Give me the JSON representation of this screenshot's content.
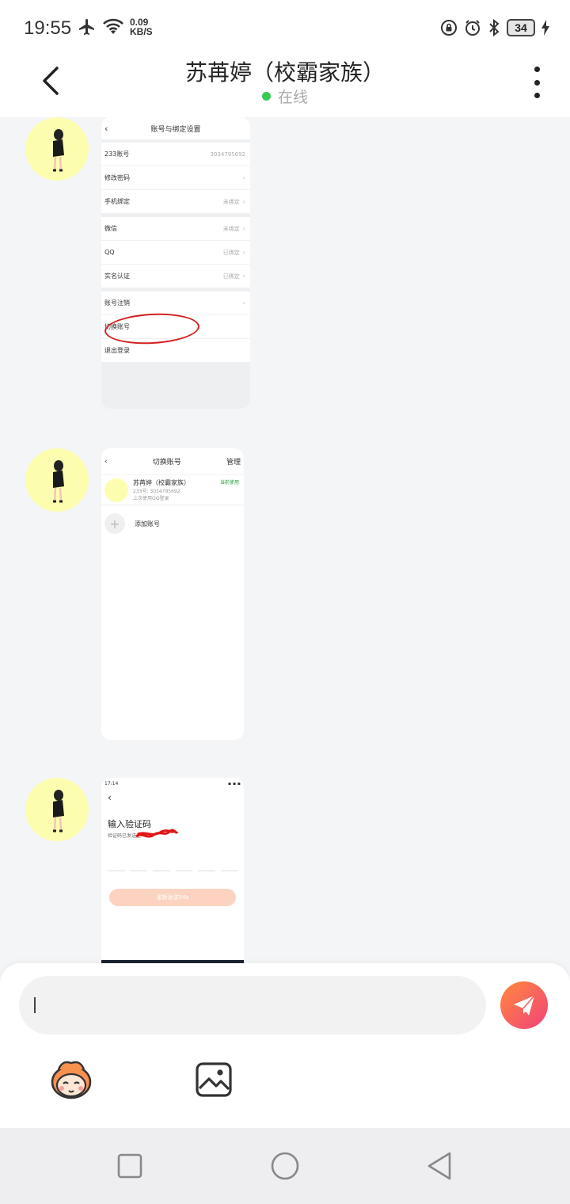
{
  "status_bar": {
    "time": "19:55",
    "net_speed_value": "0.09",
    "net_speed_unit": "KB/S",
    "battery": "34"
  },
  "header": {
    "title": "苏苒婷（校霸家族）",
    "status": "在线"
  },
  "messages": [
    {
      "shot": {
        "title": "账号与绑定设置",
        "rows": [
          {
            "label": "233账号",
            "value": "3034795692"
          },
          {
            "label": "修改密码",
            "value": ""
          },
          {
            "label": "手机绑定",
            "value": "未绑定"
          },
          {
            "label": "微信",
            "value": "未绑定"
          },
          {
            "label": "QQ",
            "value": "已绑定"
          },
          {
            "label": "实名认证",
            "value": "已绑定"
          },
          {
            "label": "账号注销",
            "value": ""
          },
          {
            "label": "切换账号",
            "value": ""
          },
          {
            "label": "退出登录",
            "value": ""
          }
        ]
      }
    },
    {
      "shot": {
        "title": "切换账号",
        "manage": "管理",
        "account_name": "苏苒婷（校霸家族）",
        "account_id": "233号: 3034795692",
        "account_note": "上次使用QQ登录",
        "current_label": "当前使用",
        "add_label": "添加账号"
      }
    },
    {
      "shot": {
        "time": "17:14",
        "title": "输入验证码",
        "subtitle": "验证码已发送至",
        "resend": "重新发送54s"
      }
    }
  ],
  "input": {
    "placeholder": ""
  },
  "colors": {
    "online_dot": "#33cc55",
    "send_gradient_start": "#ff8a3d",
    "send_gradient_end": "#f2427a",
    "avatar_bg": "#fdfdb0"
  }
}
